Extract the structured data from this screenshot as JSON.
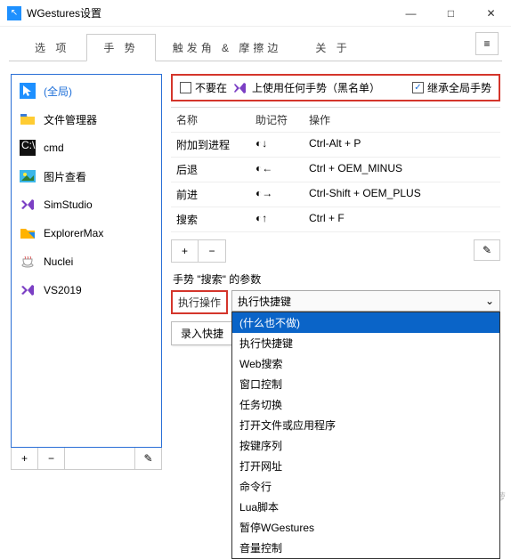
{
  "window": {
    "title": "WGestures设置",
    "minimize": "—",
    "maximize": "□",
    "close": "✕",
    "menu": "≡"
  },
  "tabs": [
    "选  项",
    "手  势",
    "触发角 & 摩擦边",
    "关  于"
  ],
  "activeTab": 1,
  "sidebar": {
    "items": [
      {
        "label": "(全局)",
        "icon": "cursor"
      },
      {
        "label": "文件管理器",
        "icon": "folder"
      },
      {
        "label": "cmd",
        "icon": "cmd"
      },
      {
        "label": "图片查看",
        "icon": "image"
      },
      {
        "label": "SimStudio",
        "icon": "vs"
      },
      {
        "label": "ExplorerMax",
        "icon": "folderx"
      },
      {
        "label": "Nuclei",
        "icon": "coffee"
      },
      {
        "label": "VS2019",
        "icon": "vs"
      }
    ],
    "selected": 0,
    "add": "+",
    "remove": "−",
    "edit": "✎"
  },
  "topopts": {
    "blacklist_cb": false,
    "blacklist_pre": "不要在",
    "blacklist_post": "上使用任何手势（黑名单）",
    "inherit_cb": true,
    "inherit": "继承全局手势"
  },
  "table": {
    "headers": [
      "名称",
      "助记符",
      "操作"
    ],
    "rows": [
      {
        "name": "附加到进程",
        "mnem": "◐↓",
        "op": "Ctrl-Alt + P"
      },
      {
        "name": "后退",
        "mnem": "◐←",
        "op": "Ctrl + OEM_MINUS"
      },
      {
        "name": "前进",
        "mnem": "◐→",
        "op": "Ctrl-Shift + OEM_PLUS"
      },
      {
        "name": "搜索",
        "mnem": "◐↑",
        "op": "Ctrl + F"
      }
    ],
    "add": "+",
    "remove": "−",
    "edit": "✎"
  },
  "params": {
    "title": "手势 \"搜索\" 的参数",
    "label": "执行操作",
    "selected": "执行快捷键",
    "options": [
      "(什么也不做)",
      "执行快捷键",
      "Web搜索",
      "窗口控制",
      "任务切换",
      "打开文件或应用程序",
      "按键序列",
      "打开网址",
      "命令行",
      "Lua脚本",
      "暂停WGestures",
      "音量控制"
    ],
    "highlighted": 0,
    "recbtn": "录入快捷"
  },
  "watermark": "@勾牙利认真的小菠萝"
}
